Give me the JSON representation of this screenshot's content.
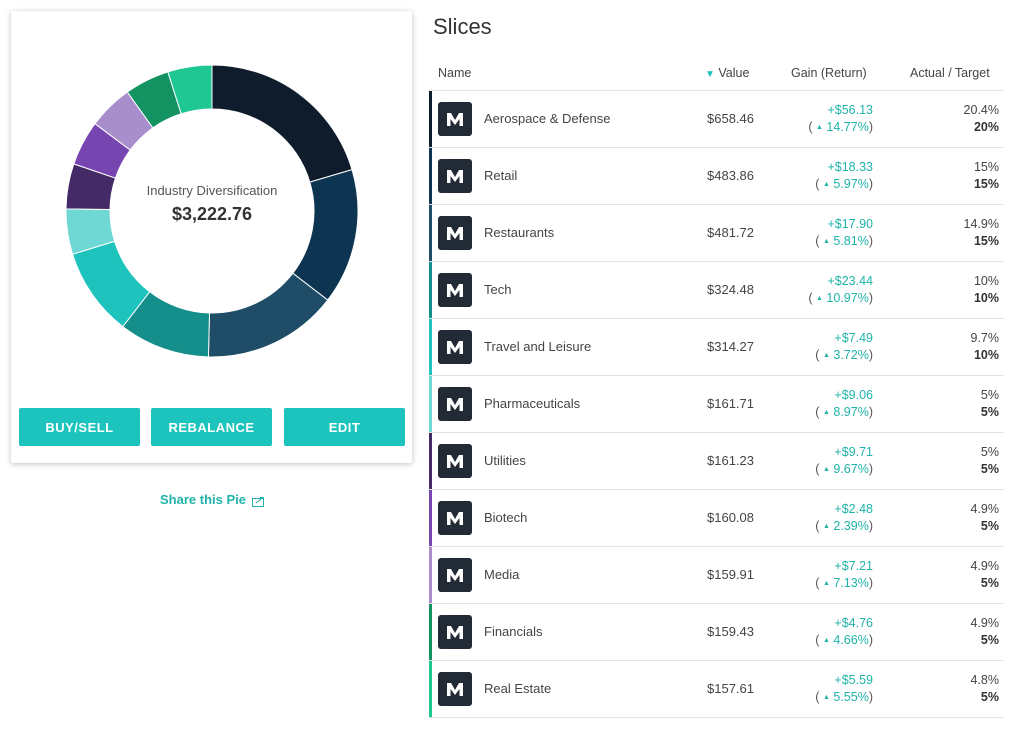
{
  "pie": {
    "name": "Industry Diversification",
    "total": "$3,222.76"
  },
  "buttons": {
    "buy_sell": "BUY/SELL",
    "rebalance": "REBALANCE",
    "edit": "EDIT"
  },
  "share": {
    "label": "Share this Pie",
    "icon": "share-icon"
  },
  "slices_title": "Slices",
  "columns": {
    "name": "Name",
    "value": "Value",
    "sort_indicator": "▼",
    "gain": "Gain (Return)",
    "actual_target": "Actual / Target"
  },
  "colors": {
    "accent": "#1cc4bd",
    "gain": "#1fb3a9"
  },
  "rows": [
    {
      "name": "Aerospace & Defense",
      "value": "$658.46",
      "gain": "+$56.13",
      "ret": "14.77%",
      "actual": "20.4%",
      "target": "20%",
      "color": "#0f1c2b",
      "share": 0.2043
    },
    {
      "name": "Retail",
      "value": "$483.86",
      "gain": "+$18.33",
      "ret": "5.97%",
      "actual": "15%",
      "target": "15%",
      "color": "#0d3552",
      "share": 0.1501
    },
    {
      "name": "Restaurants",
      "value": "$481.72",
      "gain": "+$17.90",
      "ret": "5.81%",
      "actual": "14.9%",
      "target": "15%",
      "color": "#1f4d68",
      "share": 0.1495
    },
    {
      "name": "Tech",
      "value": "$324.48",
      "gain": "+$23.44",
      "ret": "10.97%",
      "actual": "10%",
      "target": "10%",
      "color": "#138e8a",
      "share": 0.1007
    },
    {
      "name": "Travel and Leisure",
      "value": "$314.27",
      "gain": "+$7.49",
      "ret": "3.72%",
      "actual": "9.7%",
      "target": "10%",
      "color": "#1ec3bd",
      "share": 0.0975
    },
    {
      "name": "Pharmaceuticals",
      "value": "$161.71",
      "gain": "+$9.06",
      "ret": "8.97%",
      "actual": "5%",
      "target": "5%",
      "color": "#6fd8d4",
      "share": 0.0502
    },
    {
      "name": "Utilities",
      "value": "$161.23",
      "gain": "+$9.71",
      "ret": "9.67%",
      "actual": "5%",
      "target": "5%",
      "color": "#442a66",
      "share": 0.05
    },
    {
      "name": "Biotech",
      "value": "$160.08",
      "gain": "+$2.48",
      "ret": "2.39%",
      "actual": "4.9%",
      "target": "5%",
      "color": "#7745b0",
      "share": 0.0497
    },
    {
      "name": "Media",
      "value": "$159.91",
      "gain": "+$7.21",
      "ret": "7.13%",
      "actual": "4.9%",
      "target": "5%",
      "color": "#a88fcc",
      "share": 0.0496
    },
    {
      "name": "Financials",
      "value": "$159.43",
      "gain": "+$4.76",
      "ret": "4.66%",
      "actual": "4.9%",
      "target": "5%",
      "color": "#139262",
      "share": 0.0495
    },
    {
      "name": "Real Estate",
      "value": "$157.61",
      "gain": "+$5.59",
      "ret": "5.55%",
      "actual": "4.8%",
      "target": "5%",
      "color": "#1fc792",
      "share": 0.0489
    }
  ]
}
